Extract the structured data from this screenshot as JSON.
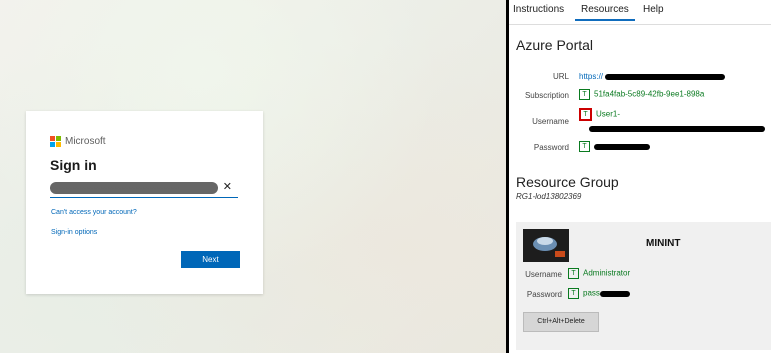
{
  "signin": {
    "brand": "Microsoft",
    "title": "Sign in",
    "email_value": "xxxxxxxxxxxxxxxxxxxxxxxxxxxxxxxxxxxxx",
    "cant_access": "Can't access your account?",
    "signin_options": "Sign-in options",
    "next": "Next"
  },
  "panel": {
    "tabs": [
      "Instructions",
      "Resources",
      "Help"
    ],
    "active_tab": "Resources",
    "portal_title": "Azure Portal",
    "rows": [
      {
        "label": "URL",
        "value": "https://"
      },
      {
        "label": "Subscription",
        "value": "51fa4fab-5c89-42fb-9ee1-898a"
      },
      {
        "label": "Username",
        "value": "User1-"
      },
      {
        "label": "Password",
        "value": ""
      }
    ],
    "rg_title": "Resource Group",
    "rg_id": "RG1-lod13802369",
    "vm": {
      "name": "MININT",
      "username_label": "Username",
      "username_value": "Administrator",
      "password_label": "Password",
      "password_value": "pass",
      "cad": "Ctrl+Alt+Delete"
    }
  },
  "colors": {
    "accent": "#0067b8",
    "tab_accent": "#0f6cbd",
    "green_text": "#0a7a20",
    "selected_border": "#c00000"
  }
}
